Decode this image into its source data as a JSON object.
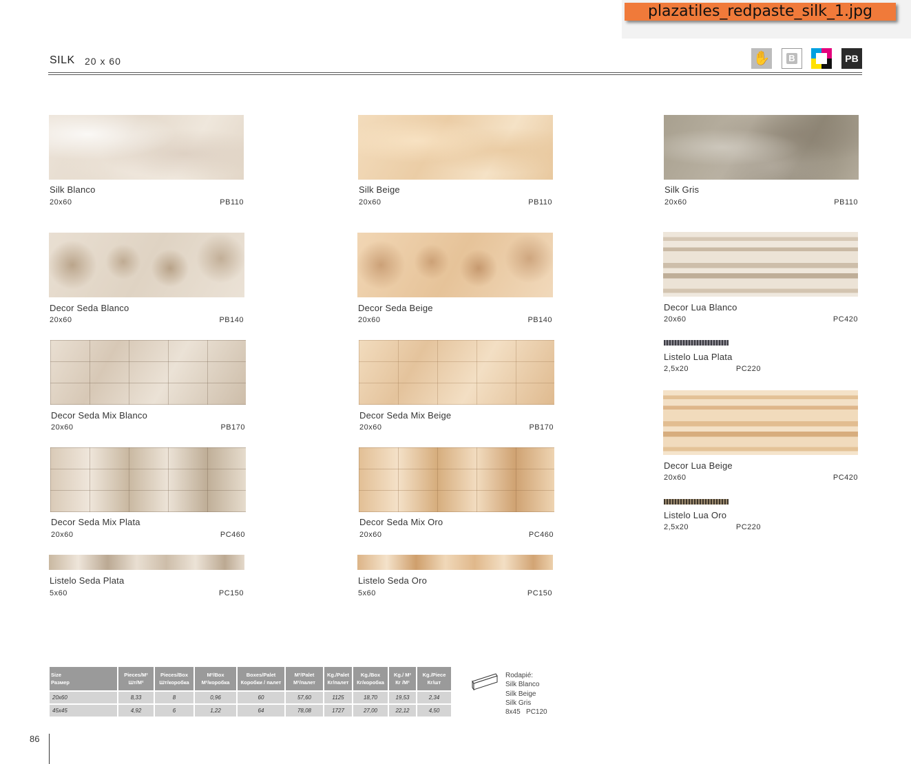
{
  "file_tag": "plazatiles_redpaste_silk_1.jpg",
  "header": {
    "title": "SILK",
    "size": "20 x 60"
  },
  "badges": {
    "b": "B",
    "pb": "PB"
  },
  "tiles": [
    {
      "name": "Silk Blanco",
      "size": "20x60",
      "code": "PB110"
    },
    {
      "name": "Silk Beige",
      "size": "20x60",
      "code": "PB110"
    },
    {
      "name": "Silk Gris",
      "size": "20x60",
      "code": "PB110"
    },
    {
      "name": "Decor Seda Blanco",
      "size": "20x60",
      "code": "PB140"
    },
    {
      "name": "Decor Seda Beige",
      "size": "20x60",
      "code": "PB140"
    },
    {
      "name": "Decor Lua Blanco",
      "size": "20x60",
      "code": "PC420"
    },
    {
      "name": "Listelo Lua Plata",
      "size": "2,5x20",
      "code": "PC220"
    },
    {
      "name": "Decor Seda Mix Blanco",
      "size": "20x60",
      "code": "PB170"
    },
    {
      "name": "Decor Seda Mix Beige",
      "size": "20x60",
      "code": "PB170"
    },
    {
      "name": "Decor Lua Beige",
      "size": "20x60",
      "code": "PC420"
    },
    {
      "name": "Listelo Lua Oro",
      "size": "2,5x20",
      "code": "PC220"
    },
    {
      "name": "Decor Seda Mix Plata",
      "size": "20x60",
      "code": "PC460"
    },
    {
      "name": "Decor Seda Mix Oro",
      "size": "20x60",
      "code": "PC460"
    },
    {
      "name": "Listelo Seda Plata",
      "size": "5x60",
      "code": "PC150"
    },
    {
      "name": "Listelo Seda Oro",
      "size": "5x60",
      "code": "PC150"
    }
  ],
  "table": {
    "headers": [
      [
        "Size",
        "Размер"
      ],
      [
        "Pieces/M²",
        "Шт/M²"
      ],
      [
        "Pieces/Box",
        "Шт/коробка"
      ],
      [
        "M²/Box",
        "M²/коробка"
      ],
      [
        "Boxes/Palet",
        "Коробки / палет"
      ],
      [
        "M²/Palet",
        "M²/палет"
      ],
      [
        "Kg./Palet",
        "Кг/палет"
      ],
      [
        "Kg./Box",
        "Кг/коробка"
      ],
      [
        "Kg./ M²",
        "Кг /M²"
      ],
      [
        "Kg./Piece",
        "Кг/шт"
      ]
    ],
    "rows": [
      [
        "20x60",
        "8,33",
        "8",
        "0,96",
        "60",
        "57,60",
        "1125",
        "18,70",
        "19,53",
        "2,34"
      ],
      [
        "45x45",
        "4,92",
        "6",
        "1,22",
        "64",
        "78,08",
        "1727",
        "27,00",
        "22,12",
        "4,50"
      ]
    ]
  },
  "rodapie": {
    "title": "Rodapié:",
    "items": [
      "Silk Blanco",
      "Silk Beige",
      "Silk Gris"
    ],
    "size": "8x45",
    "code": "PC120"
  },
  "page_number": "86"
}
